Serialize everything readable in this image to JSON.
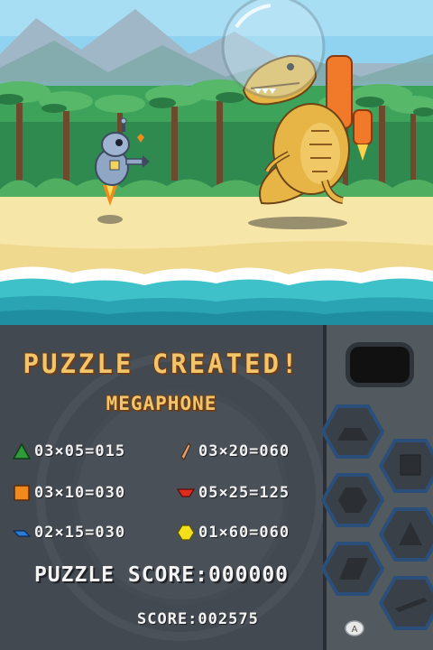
{
  "result": {
    "title": "PUZZLE CREATED!",
    "puzzle_name": "MEGAPHONE",
    "rows": [
      {
        "shape": "green-triangle-icon",
        "color": "#2e9a3a",
        "text": "03×05=015"
      },
      {
        "shape": "tan-shard-icon",
        "color": "#d8a27a",
        "text": "03×20=060"
      },
      {
        "shape": "orange-square-icon",
        "color": "#f08a1c",
        "text": "03×10=030"
      },
      {
        "shape": "red-trapezoid-icon",
        "color": "#e02b1f",
        "text": "05×25=125"
      },
      {
        "shape": "blue-parallelogram-icon",
        "color": "#2c7bd6",
        "text": "02×15=030"
      },
      {
        "shape": "yellow-hexagon-icon",
        "color": "#f4e01a",
        "text": "01×60=060"
      }
    ],
    "puzzle_score": "PUZZLE SCORE:000000",
    "total_score": "SCORE:002575"
  },
  "right_panel": {
    "buttons": [
      "trapezoid-slot-icon",
      "square-slot-icon",
      "hexagon-slot-icon",
      "triangle-slot-icon",
      "parallelogram-slot-icon",
      "shard-slot-icon"
    ]
  },
  "controls": {
    "a_button": "A"
  },
  "colors": {
    "title_text": "#f2c56b",
    "panel_bg": "#434950",
    "sky": "#8fd3f0",
    "sand": "#f6e6a8",
    "sea": "#3fc1c9"
  }
}
